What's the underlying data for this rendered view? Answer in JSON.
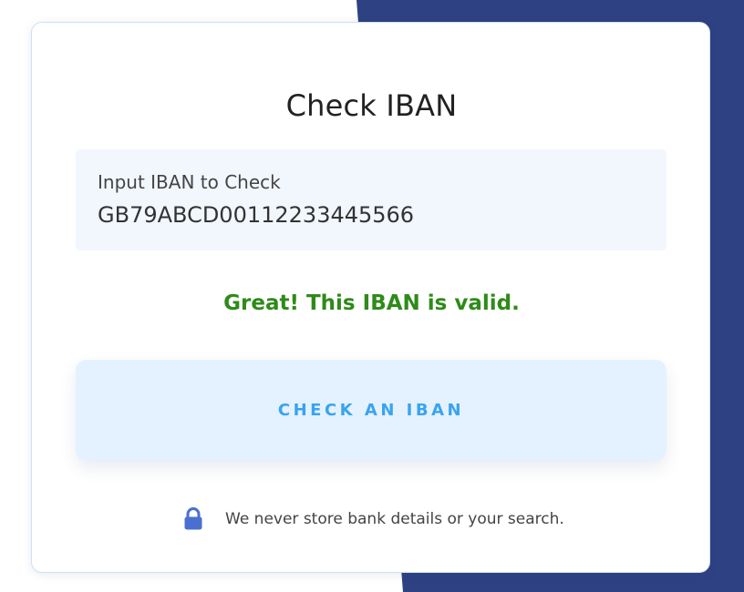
{
  "card": {
    "title": "Check IBAN"
  },
  "iban_input": {
    "label": "Input IBAN to Check",
    "value": "GB79ABCD00112233445566"
  },
  "result": {
    "message": "Great! This IBAN is valid.",
    "color": "#2f8a1a"
  },
  "check_button": {
    "label": "CHECK AN IBAN"
  },
  "privacy_note": {
    "icon": "lock-icon",
    "text": "We never store bank details or your search."
  },
  "colors": {
    "background_accent": "#2e4183",
    "button_bg": "#e3f2fe",
    "button_text": "#3aa3ef",
    "input_bg": "#f2f7fd",
    "lock_icon": "#4a6fd1"
  }
}
